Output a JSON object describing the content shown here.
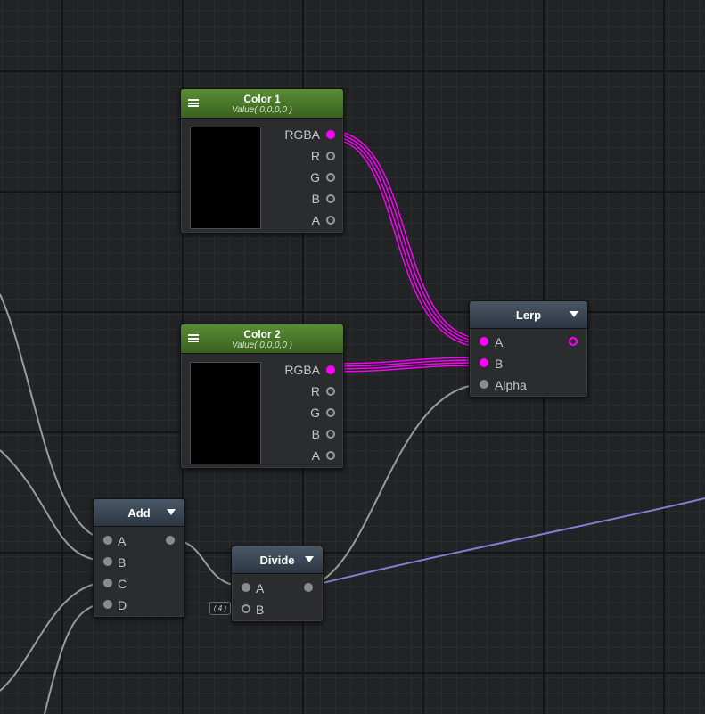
{
  "colors": {
    "accent_magenta": "#ff00ff",
    "wire_gray": "#9a9a9a",
    "wire_blue": "#7f7fd4",
    "color_node_header": "#4f7d2d",
    "op_node_header": "#3a4654"
  },
  "nodes": {
    "color1": {
      "title": "Color 1",
      "subtitle": "Value( 0,0,0,0 )",
      "outputs": [
        "RGBA",
        "R",
        "G",
        "B",
        "A"
      ]
    },
    "color2": {
      "title": "Color 2",
      "subtitle": "Value( 0,0,0,0 )",
      "outputs": [
        "RGBA",
        "R",
        "G",
        "B",
        "A"
      ]
    },
    "lerp": {
      "title": "Lerp",
      "inputs": [
        "A",
        "B",
        "Alpha"
      ]
    },
    "add": {
      "title": "Add",
      "inputs": [
        "A",
        "B",
        "C",
        "D"
      ]
    },
    "divide": {
      "title": "Divide",
      "inputs": [
        "A",
        "B"
      ],
      "b_default": "( 4 )"
    }
  },
  "icons": [
    "hamburger-menu-icon",
    "dropdown-triangle-icon"
  ]
}
